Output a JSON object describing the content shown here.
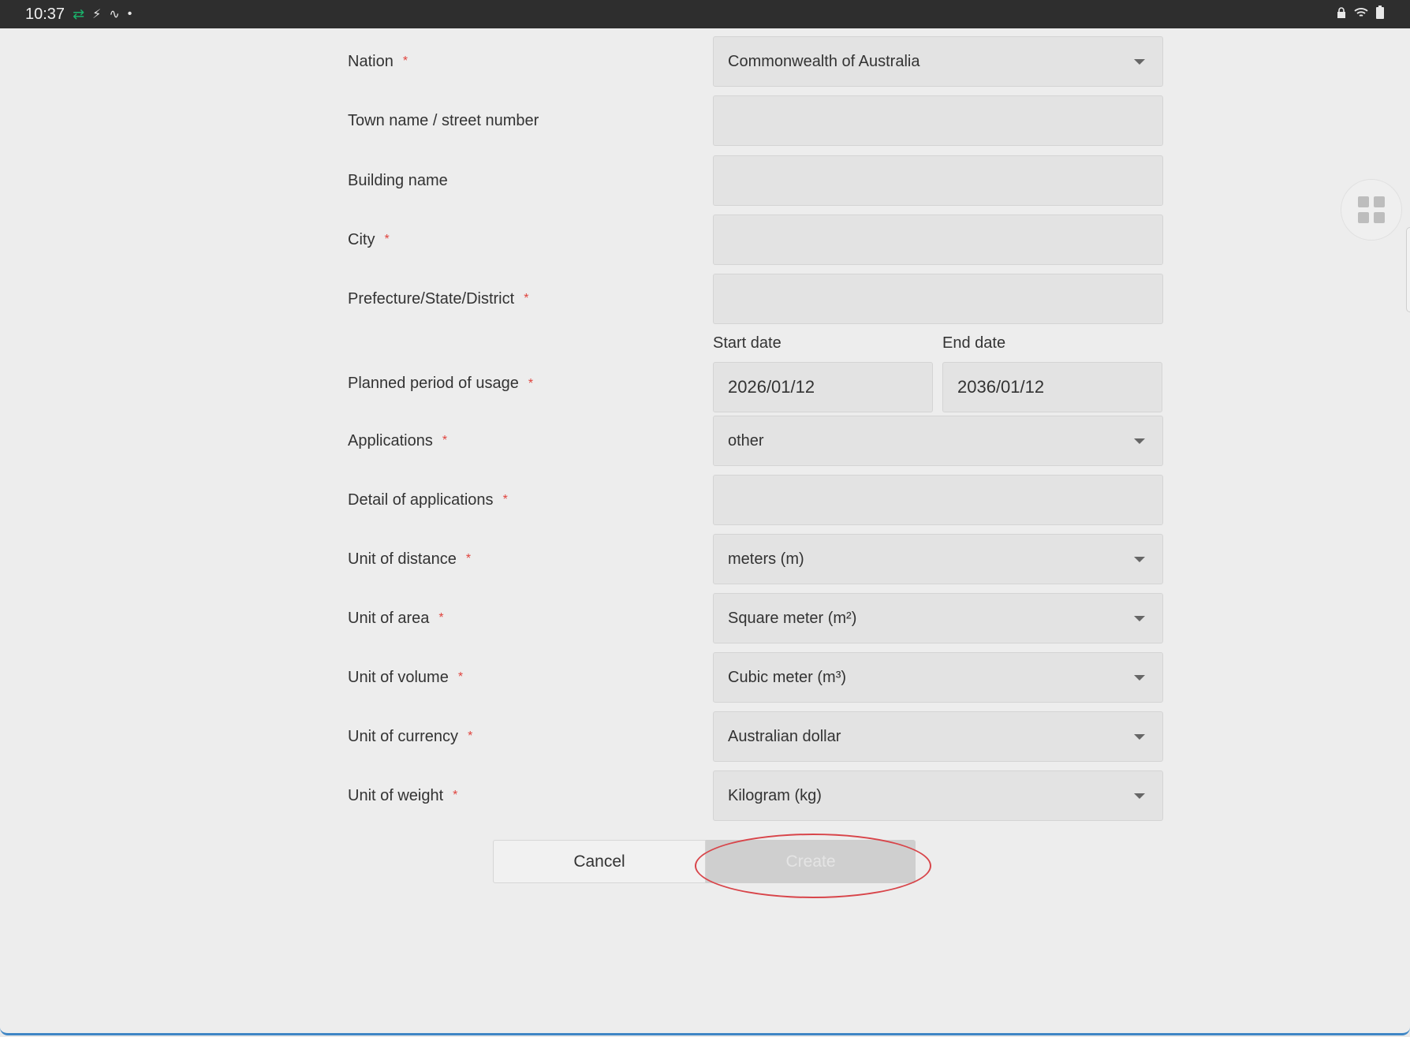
{
  "status_bar": {
    "time": "10:37"
  },
  "form": {
    "rows": [
      {
        "label": "Nation",
        "required_mark": "*",
        "value": "Commonwealth of Australia"
      },
      {
        "label": "Town name / street number",
        "value": ""
      },
      {
        "label": "Building name",
        "value": ""
      },
      {
        "label": "City",
        "required_mark": "*",
        "value": ""
      },
      {
        "label": "Prefecture/State/District",
        "required_mark": "*",
        "value": ""
      },
      {
        "label": "Planned period of usage",
        "required_mark": "*"
      },
      {
        "label": "Applications",
        "required_mark": "*",
        "value": "other"
      },
      {
        "label": "Detail of applications",
        "required_mark": "*",
        "value": ""
      },
      {
        "label": "Unit of distance",
        "required_mark": "*",
        "value": "meters (m)"
      },
      {
        "label": "Unit of area",
        "required_mark": "*",
        "value": "Square meter (m²)"
      },
      {
        "label": "Unit of volume",
        "required_mark": "*",
        "value": "Cubic meter (m³)"
      },
      {
        "label": "Unit of currency",
        "required_mark": "*",
        "value": "Australian dollar"
      },
      {
        "label": "Unit of weight",
        "required_mark": "*",
        "value": "Kilogram (kg)"
      }
    ],
    "period": {
      "start_label": "Start date",
      "start_value": "2026/01/12",
      "end_label": "End date",
      "end_value": "2036/01/12"
    }
  },
  "buttons": {
    "cancel": "Cancel",
    "create": "Create"
  },
  "icons": {
    "status_sync": "sync-arrows-icon",
    "status_activity": "activity-icon",
    "status_lock": "lock-icon",
    "status_wifi": "wifi-icon",
    "status_battery": "battery-icon",
    "floating": "grid-apps-icon",
    "dropdown": "chevron-down-icon"
  },
  "colors": {
    "required": "#e0433d",
    "highlight_ring": "#d8454a",
    "accent_border": "#3f86c5"
  }
}
